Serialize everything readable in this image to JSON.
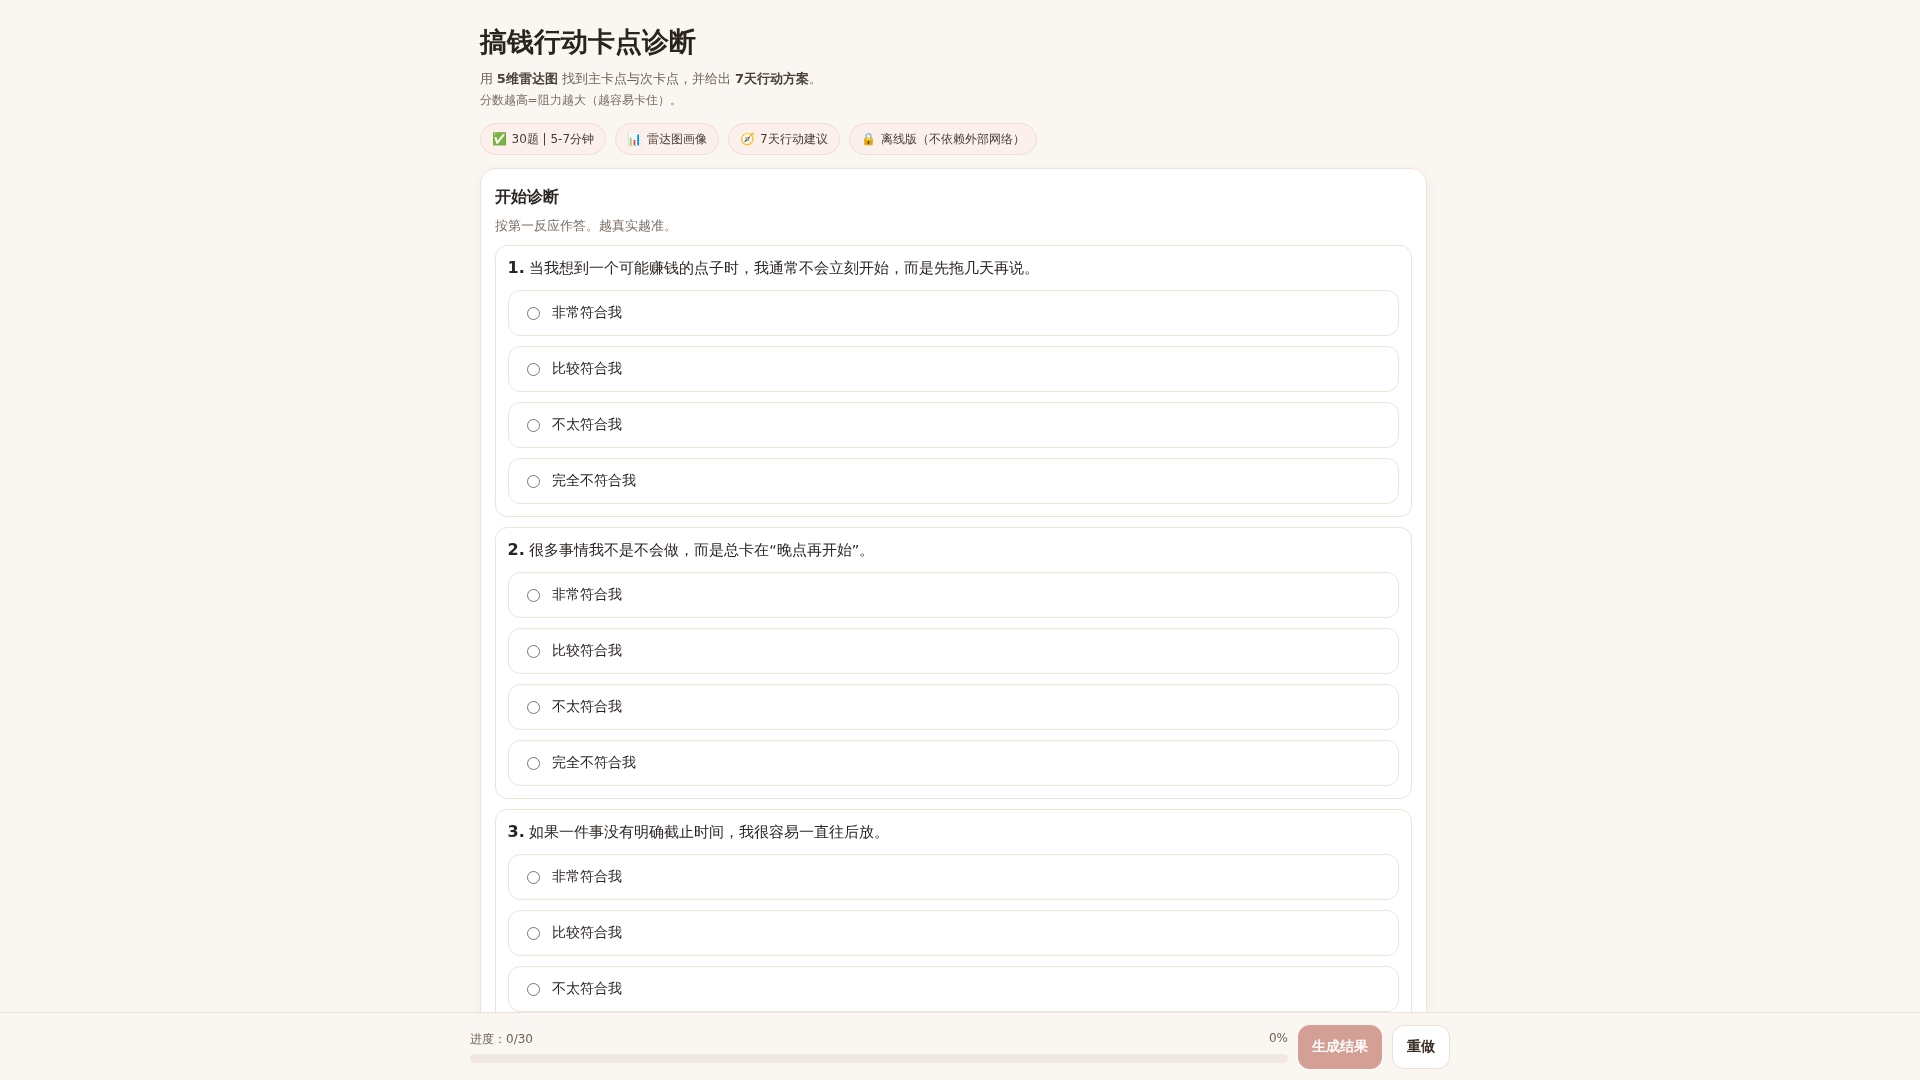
{
  "header": {
    "title": "搞钱行动卡点诊断",
    "subtitle": "用 **5维雷达图** 找到主卡点与次卡点，并给出 **7天行动方案**。",
    "note": "分数越高=阻力越大（越容易卡住）。"
  },
  "chips": [
    {
      "icon": "✅",
      "label": "30题 | 5-7分钟"
    },
    {
      "icon": "📊",
      "label": "雷达图画像"
    },
    {
      "icon": "🧭",
      "label": "7天行动建议"
    },
    {
      "icon": "🔒",
      "label": "离线版（不依赖外部网络）"
    }
  ],
  "card": {
    "title": "开始诊断",
    "hint": "按第一反应作答。越真实越准。"
  },
  "questions": [
    {
      "number": "1.",
      "text": "当我想到一个可能赚钱的点子时，我通常不会立刻开始，而是先拖几天再说。",
      "options": [
        {
          "label": "非常符合我",
          "selected": false
        },
        {
          "label": "比较符合我",
          "selected": false
        },
        {
          "label": "不太符合我",
          "selected": false
        },
        {
          "label": "完全不符合我",
          "selected": false
        }
      ]
    },
    {
      "number": "2.",
      "text": "很多事情我不是不会做，而是总卡在“晚点再开始”。",
      "options": [
        {
          "label": "非常符合我",
          "selected": false
        },
        {
          "label": "比较符合我",
          "selected": false
        },
        {
          "label": "不太符合我",
          "selected": false
        },
        {
          "label": "完全不符合我",
          "selected": false
        }
      ]
    },
    {
      "number": "3.",
      "text": "如果一件事没有明确截止时间，我很容易一直往后放。",
      "options": [
        {
          "label": "非常符合我",
          "selected": false
        },
        {
          "label": "比较符合我",
          "selected": false
        },
        {
          "label": "不太符合我",
          "selected": false
        }
      ]
    }
  ],
  "footer": {
    "progress_label": "进度：0/30",
    "percent": "0%",
    "level": 0,
    "buttons": [
      {
        "label": "生成结果",
        "kind": "primary",
        "disabled": true
      },
      {
        "label": "重做",
        "kind": "secondary",
        "disabled": false
      }
    ]
  }
}
